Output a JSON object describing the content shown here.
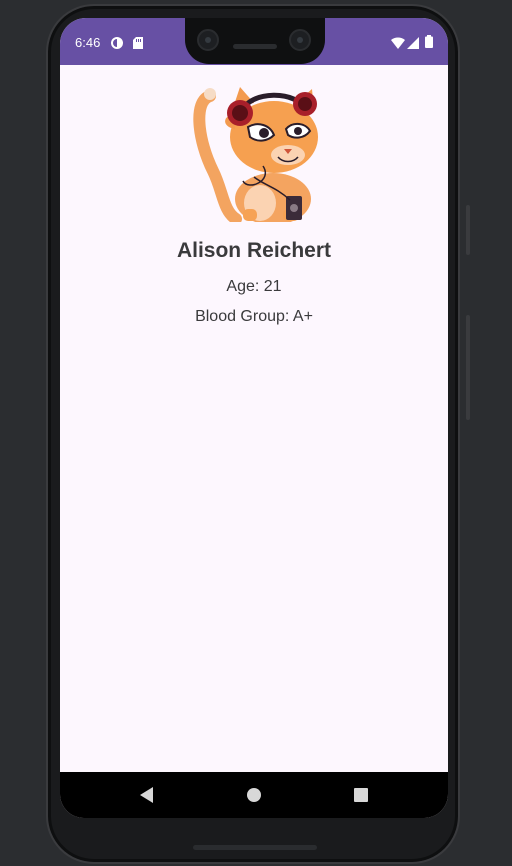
{
  "status_bar": {
    "time": "6:46",
    "icons": [
      "data-saver-icon",
      "sd-card-icon",
      "wifi-icon",
      "signal-icon",
      "battery-icon"
    ],
    "color": "#6750a4"
  },
  "profile": {
    "image": "cat-with-headphones-avatar",
    "name": "Alison Reichert",
    "age": "Age: 21",
    "blood_group": "Blood Group: A+"
  },
  "nav_bar": {
    "buttons": [
      "back-icon",
      "home-icon",
      "recents-icon"
    ]
  }
}
